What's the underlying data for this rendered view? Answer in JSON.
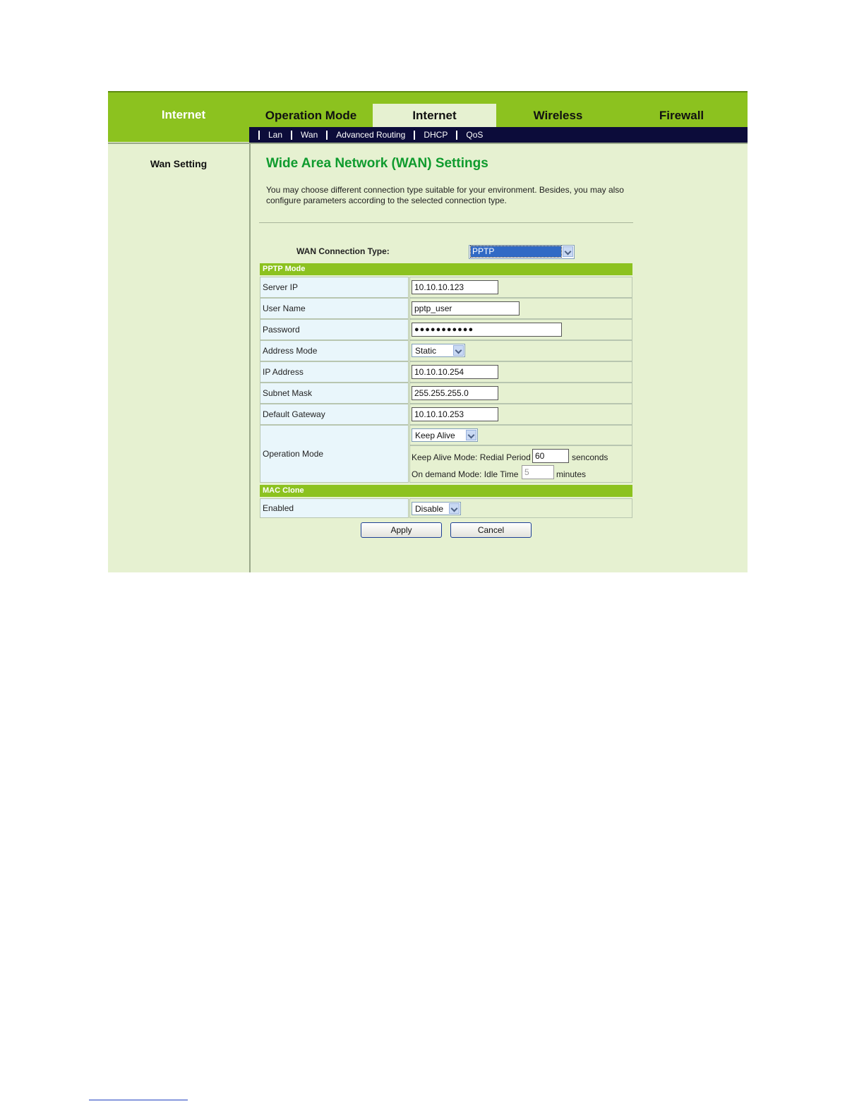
{
  "header": {
    "title": "Internet",
    "tabs": [
      {
        "label": "Operation Mode"
      },
      {
        "label": "Internet",
        "active": true
      },
      {
        "label": "Wireless"
      },
      {
        "label": "Firewall"
      }
    ],
    "subnav": [
      "Lan",
      "Wan",
      "Advanced Routing",
      "DHCP",
      "QoS"
    ]
  },
  "sidebar": {
    "items": [
      {
        "label": "Wan Setting"
      }
    ]
  },
  "main": {
    "title": "Wide Area Network (WAN) Settings",
    "description_line1": "You may choose different connection type suitable for your environment. Besides, you may also",
    "description_line2": "configure parameters according to the selected connection type.",
    "connection_type_label": "WAN Connection Type:",
    "connection_type_value": "PPTP",
    "pptp_section": "PPTP Mode",
    "fields": {
      "server_ip": {
        "label": "Server IP",
        "value": "10.10.10.123"
      },
      "user_name": {
        "label": "User Name",
        "value": "pptp_user"
      },
      "password": {
        "label": "Password",
        "value": "●●●●●●●●●●●"
      },
      "address_mode": {
        "label": "Address Mode",
        "value": "Static"
      },
      "ip_address": {
        "label": "IP Address",
        "value": "10.10.10.254"
      },
      "subnet_mask": {
        "label": "Subnet Mask",
        "value": "255.255.255.0"
      },
      "default_gateway": {
        "label": "Default Gateway",
        "value": "10.10.10.253"
      }
    },
    "operation_mode": {
      "label": "Operation Mode",
      "value": "Keep Alive",
      "keep_alive_label": "Keep Alive Mode: Redial Period",
      "keep_alive_value": "60",
      "keep_alive_unit": "senconds",
      "on_demand_label": "On demand Mode: Idle Time",
      "on_demand_value": "5",
      "on_demand_unit": "minutes"
    },
    "mac_section": "MAC Clone",
    "mac_enabled": {
      "label": "Enabled",
      "value": "Disable"
    },
    "apply_label": "Apply",
    "cancel_label": "Cancel"
  },
  "colors": {
    "header_green": "#8cc21f",
    "panel_bg": "#e6f1d1",
    "subnav_bg": "#0c0c3a",
    "title_green": "#0f9b2e",
    "label_bg": "#e9f6fb"
  }
}
